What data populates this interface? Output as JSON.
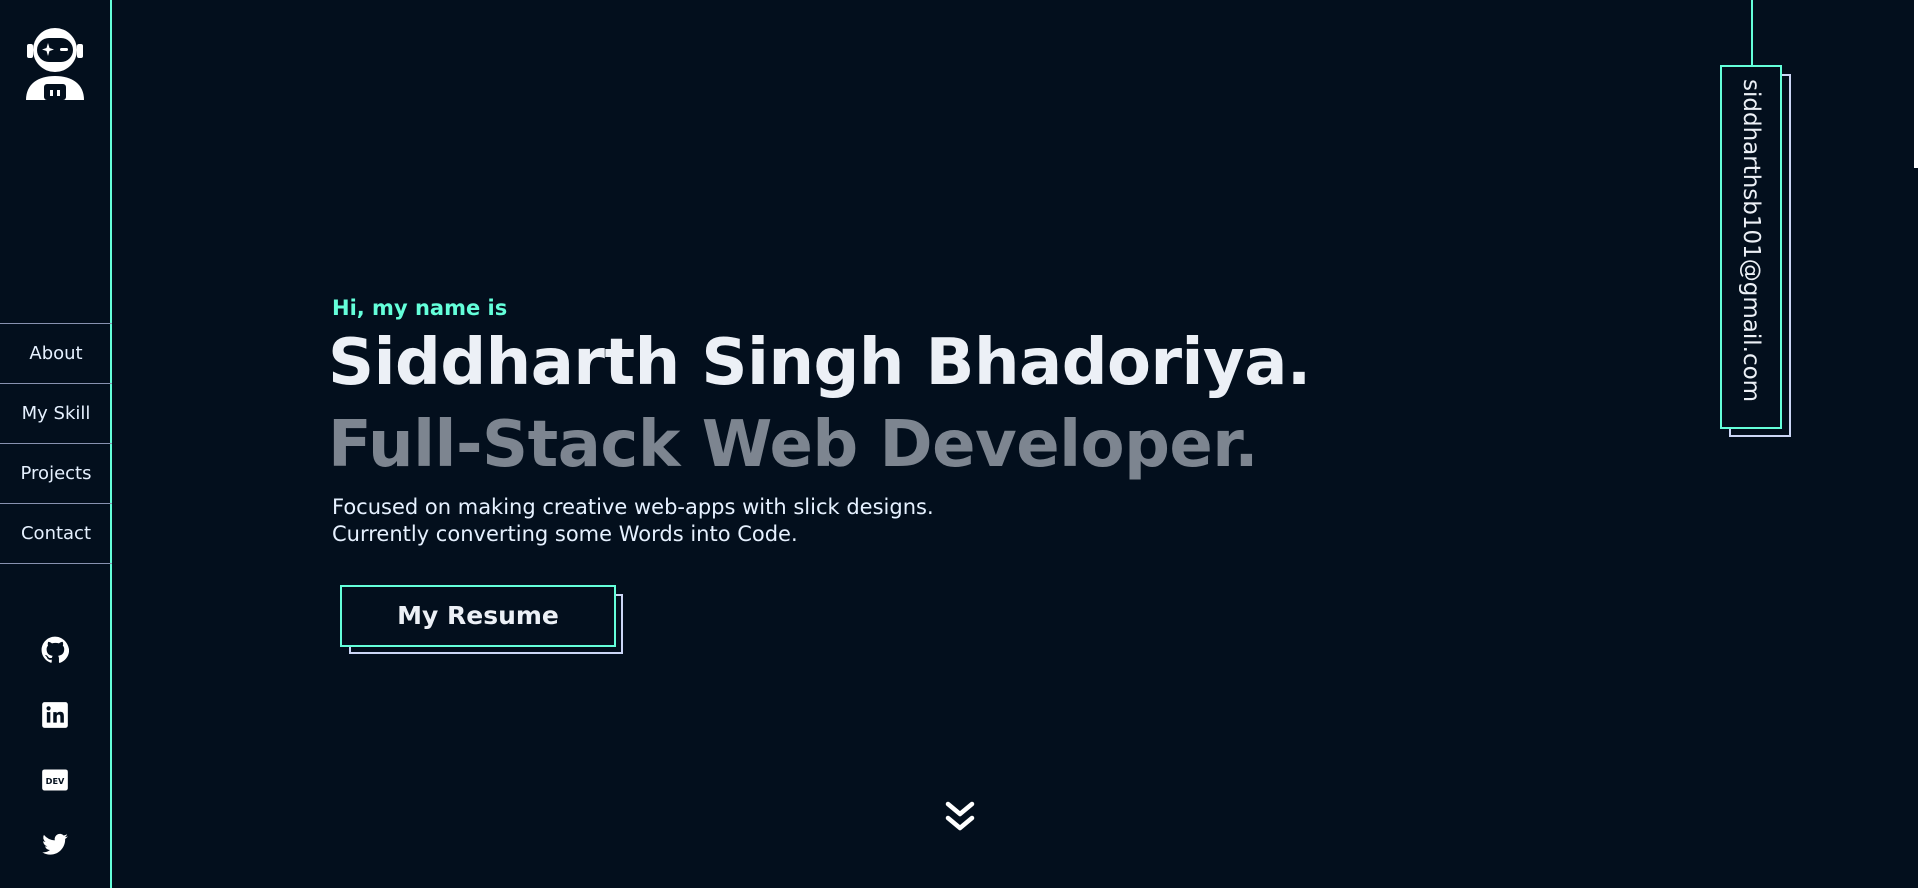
{
  "sidebar": {
    "logo_icon": "astronaut-icon",
    "nav": [
      {
        "label": "About"
      },
      {
        "label": "My Skill"
      },
      {
        "label": "Projects"
      },
      {
        "label": "Contact"
      }
    ],
    "socials": [
      {
        "icon": "github-icon"
      },
      {
        "icon": "linkedin-icon"
      },
      {
        "icon": "dev-icon"
      },
      {
        "icon": "twitter-icon"
      }
    ]
  },
  "hero": {
    "intro": "Hi, my name is",
    "name": "Siddharth Singh Bhadoriya.",
    "role": "Full-Stack Web Developer.",
    "desc_line1": "Focused on making creative web-apps with slick designs.",
    "desc_line2": "Currently converting some Words into Code.",
    "resume_label": "My Resume"
  },
  "email": "siddharthsb101@gmail.com",
  "scroll_icon": "double-chevron-down-icon",
  "colors": {
    "background": "#030f1d",
    "accent": "#64ffda",
    "text": "#ecf0f6",
    "muted": "#7d8590"
  }
}
